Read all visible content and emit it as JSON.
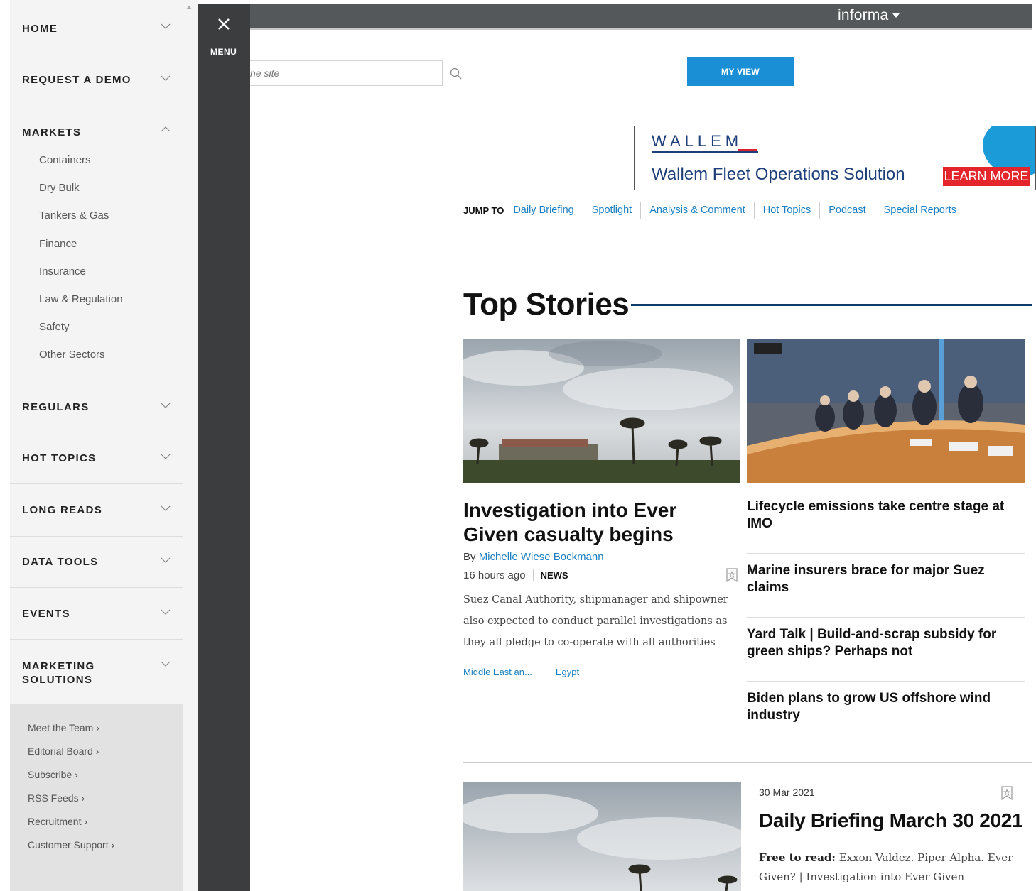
{
  "topbar": {
    "brand": "informa"
  },
  "header": {
    "search_placeholder": "he site",
    "myview_label": "MY VIEW"
  },
  "ad": {
    "brand": "WALLEM",
    "title": "Wallem Fleet Operations Solution",
    "cta": "LEARN MORE"
  },
  "jump": {
    "label": "JUMP TO",
    "links": [
      "Daily Briefing",
      "Spotlight",
      "Analysis & Comment",
      "Hot Topics",
      "Podcast",
      "Special Reports"
    ]
  },
  "top_stories": {
    "title": "Top Stories",
    "main": {
      "headline": "Investigation into Ever Given casualty begins",
      "by": "By ",
      "author": "Michelle Wiese Bockmann",
      "time": "16 hours ago",
      "type": "NEWS",
      "summary": "Suez Canal Authority, shipmanager and shipowner also expected to conduct parallel investigations as they all pledge to co-operate with all authorities",
      "tags": [
        "Middle East an...",
        "Egypt"
      ]
    },
    "side": [
      "Lifecycle emissions take centre stage at IMO",
      "Marine insurers brace for major Suez claims",
      "Yard Talk | Build-and-scrap subsidy for green ships? Perhaps not",
      "Biden plans to grow US offshore wind industry"
    ]
  },
  "daily_briefing": {
    "date": "30 Mar 2021",
    "title": "Daily Briefing March 30 2021",
    "free_label": "Free to read:",
    "text": " Exxon Valdez. Piper Alpha. Ever Given? | Investigation into Ever Given"
  },
  "menu": {
    "close_label": "MENU"
  },
  "sidebar": {
    "items": [
      "HOME",
      "REQUEST A DEMO",
      "MARKETS",
      "REGULARS",
      "HOT TOPICS",
      "LONG READS",
      "DATA TOOLS",
      "EVENTS",
      "MARKETING SOLUTIONS"
    ],
    "markets_sub": [
      "Containers",
      "Dry Bulk",
      "Tankers & Gas",
      "Finance",
      "Insurance",
      "Law & Regulation",
      "Safety",
      "Other Sectors"
    ],
    "footer": [
      "Meet the Team ›",
      "Editorial Board ›",
      "Subscribe ›",
      "RSS Feeds ›",
      "Recruitment ›",
      "Customer Support ›"
    ]
  },
  "colors": {
    "accent": "#1a8fd6",
    "link": "#1a7fc1",
    "navy": "#0c3d6b",
    "dark_strip": "#3c3d3f",
    "topbar": "#54585a"
  }
}
